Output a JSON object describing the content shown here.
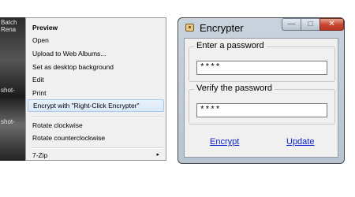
{
  "desktop": {
    "labels": [
      "Batch",
      "Rena",
      "shot-",
      "shot-"
    ]
  },
  "context_menu": {
    "items": [
      {
        "label": "Preview",
        "bold": true
      },
      {
        "label": "Open"
      },
      {
        "label": "Upload to Web Albums..."
      },
      {
        "label": "Set as desktop background"
      },
      {
        "label": "Edit"
      },
      {
        "label": "Print"
      },
      {
        "label": "Encrypt with \"Right-Click Encrypter\"",
        "highlighted": true
      },
      {
        "label": "Rotate clockwise"
      },
      {
        "label": "Rotate counterclockwise"
      },
      {
        "label": "7-Zip",
        "submenu": true
      }
    ],
    "submenu_arrow": "▸"
  },
  "window": {
    "title": "Encrypter",
    "icon": "key-icon",
    "controls": {
      "minimize": "—",
      "maximize": "□",
      "close": "✕"
    },
    "password": {
      "label": "Enter a password",
      "value": "****"
    },
    "verify": {
      "label": "Verify the password",
      "value": "****"
    },
    "encrypt_link": "Encrypt",
    "update_link": "Update"
  },
  "colors": {
    "menu_highlight": "#d9e8f8",
    "link": "#0b1fd0",
    "close_button": "#c8432e"
  }
}
